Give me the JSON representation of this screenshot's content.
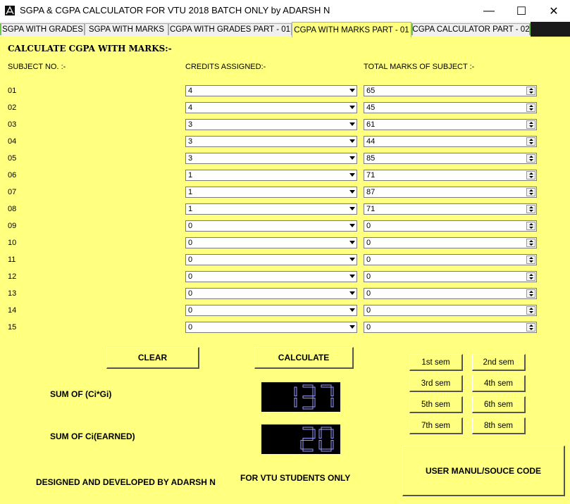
{
  "window": {
    "title": "SGPA & CGPA CALCULATOR FOR VTU 2018 BATCH ONLY by ADARSH N",
    "minimize": "—",
    "maximize": "☐",
    "close": "✕"
  },
  "tabs": [
    {
      "label": "SGPA WITH GRADES"
    },
    {
      "label": "SGPA WITH MARKS"
    },
    {
      "label": "CGPA WITH GRADES PART - 01"
    },
    {
      "label": "CGPA WITH MARKS PART - 01",
      "active": true
    },
    {
      "label": "CGPA CALCULATOR PART - 02"
    }
  ],
  "panel": {
    "heading": "CALCULATE CGPA WITH MARKS:-",
    "col_subject": "SUBJECT NO. :-",
    "col_credits": "CREDITS ASSIGNED:-",
    "col_marks": "TOTAL MARKS OF SUBJECT :-"
  },
  "rows": [
    {
      "no": "01",
      "credit": "4",
      "marks": "65"
    },
    {
      "no": "02",
      "credit": "4",
      "marks": "45"
    },
    {
      "no": "03",
      "credit": "3",
      "marks": "61"
    },
    {
      "no": "04",
      "credit": "3",
      "marks": "44"
    },
    {
      "no": "05",
      "credit": "3",
      "marks": "85"
    },
    {
      "no": "06",
      "credit": "1",
      "marks": "71"
    },
    {
      "no": "07",
      "credit": "1",
      "marks": "87"
    },
    {
      "no": "08",
      "credit": "1",
      "marks": "71"
    },
    {
      "no": "09",
      "credit": "0",
      "marks": "0"
    },
    {
      "no": "10",
      "credit": "0",
      "marks": "0"
    },
    {
      "no": "11",
      "credit": "0",
      "marks": "0"
    },
    {
      "no": "12",
      "credit": "0",
      "marks": "0"
    },
    {
      "no": "13",
      "credit": "0",
      "marks": "0"
    },
    {
      "no": "14",
      "credit": "0",
      "marks": "0"
    },
    {
      "no": "15",
      "credit": "0",
      "marks": "0"
    }
  ],
  "buttons": {
    "clear": "CLEAR",
    "calculate": "CALCULATE",
    "user_manual": "USER MANUL/SOUCE CODE"
  },
  "sem_buttons": [
    "1st sem",
    "2nd sem",
    "3rd sem",
    "4th sem",
    "5th sem",
    "6th sem",
    "7th sem",
    "8th sem"
  ],
  "results": {
    "sum_cigi_label": "SUM OF (Ci*Gi)",
    "sum_cigi_value": "137",
    "sum_ci_label": "SUM OF Ci(EARNED)",
    "sum_ci_value": "20"
  },
  "footer": {
    "designed": "DESIGNED AND DEVELOPED BY ADARSH N",
    "vtu_only": "FOR VTU STUDENTS ONLY"
  },
  "colors": {
    "panel_bg": "#ffff80",
    "lcd_bg": "#000000",
    "lcd_digit": "#9b9bff",
    "tab_accent": "#6ec845"
  }
}
